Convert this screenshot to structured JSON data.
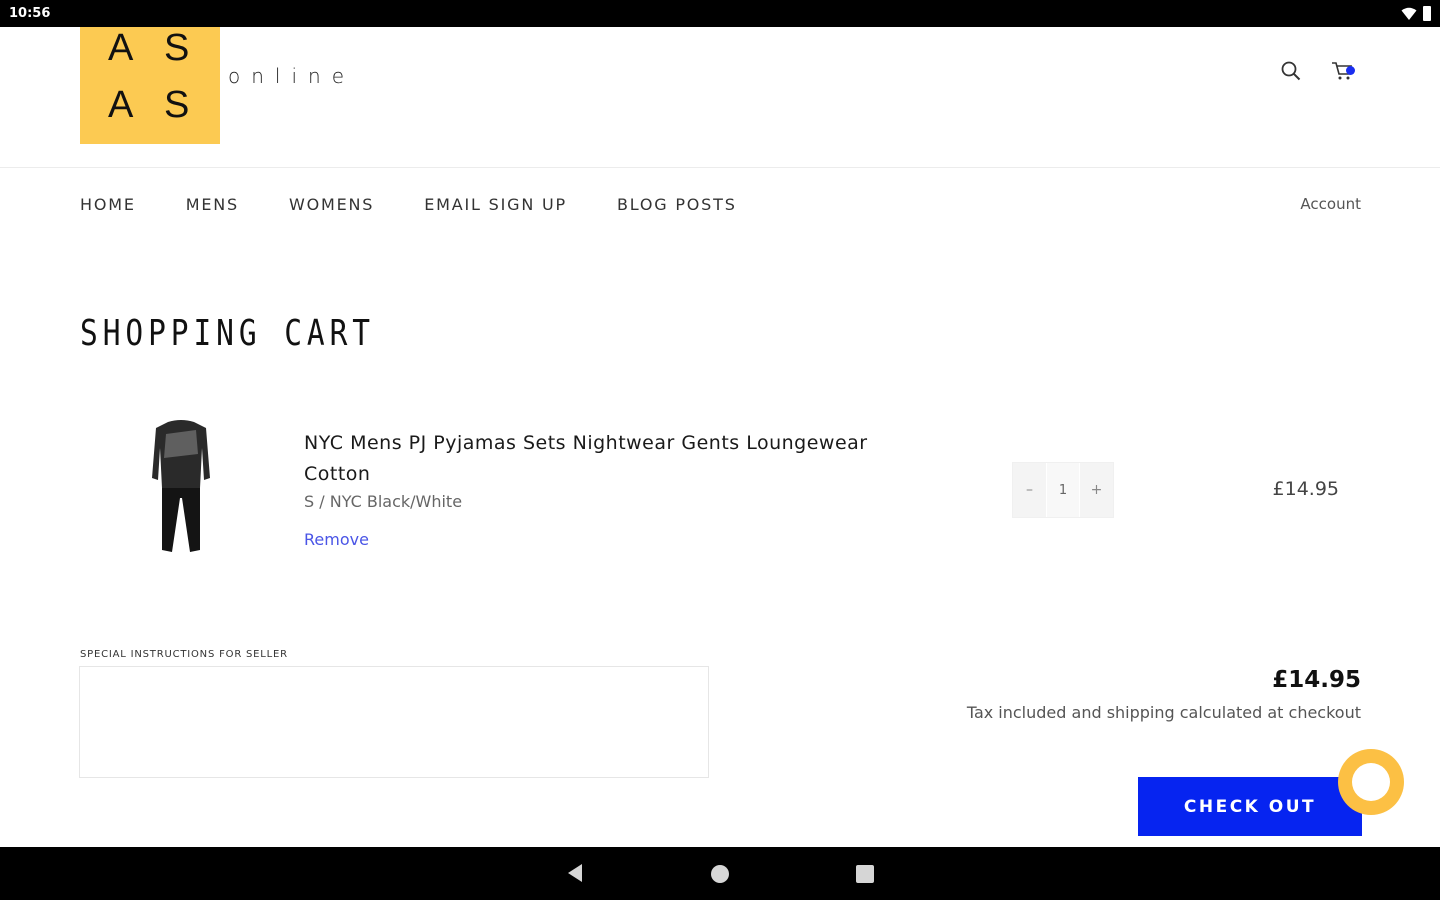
{
  "status_bar": {
    "time": "10:56"
  },
  "header": {
    "logo_letters": [
      "A",
      "S",
      "A",
      "S"
    ],
    "logo_subtitle": "online",
    "cart_badge_color": "#1a2ef0",
    "logo_bg_color": "#fcca52"
  },
  "nav": {
    "items": [
      {
        "label": "HOME"
      },
      {
        "label": "MENS"
      },
      {
        "label": "WOMENS"
      },
      {
        "label": "EMAIL SIGN UP"
      },
      {
        "label": "BLOG POSTS"
      }
    ],
    "account_label": "Account"
  },
  "page_title": "SHOPPING CART",
  "cart": {
    "items": [
      {
        "title": "NYC Mens PJ Pyjamas Sets Nightwear Gents Loungewear Cotton",
        "variant": "S / NYC Black/White",
        "remove_label": "Remove",
        "quantity": "1",
        "decrement_label": "–",
        "increment_label": "+",
        "price": "£14.95"
      }
    ]
  },
  "instructions": {
    "label": "SPECIAL INSTRUCTIONS FOR SELLER",
    "value": ""
  },
  "summary": {
    "subtotal": "£14.95",
    "tax_note": "Tax included and shipping calculated at checkout",
    "checkout_label": "CHECK OUT",
    "checkout_color": "#0624f0"
  },
  "chat_widget_color": "#fcc044"
}
